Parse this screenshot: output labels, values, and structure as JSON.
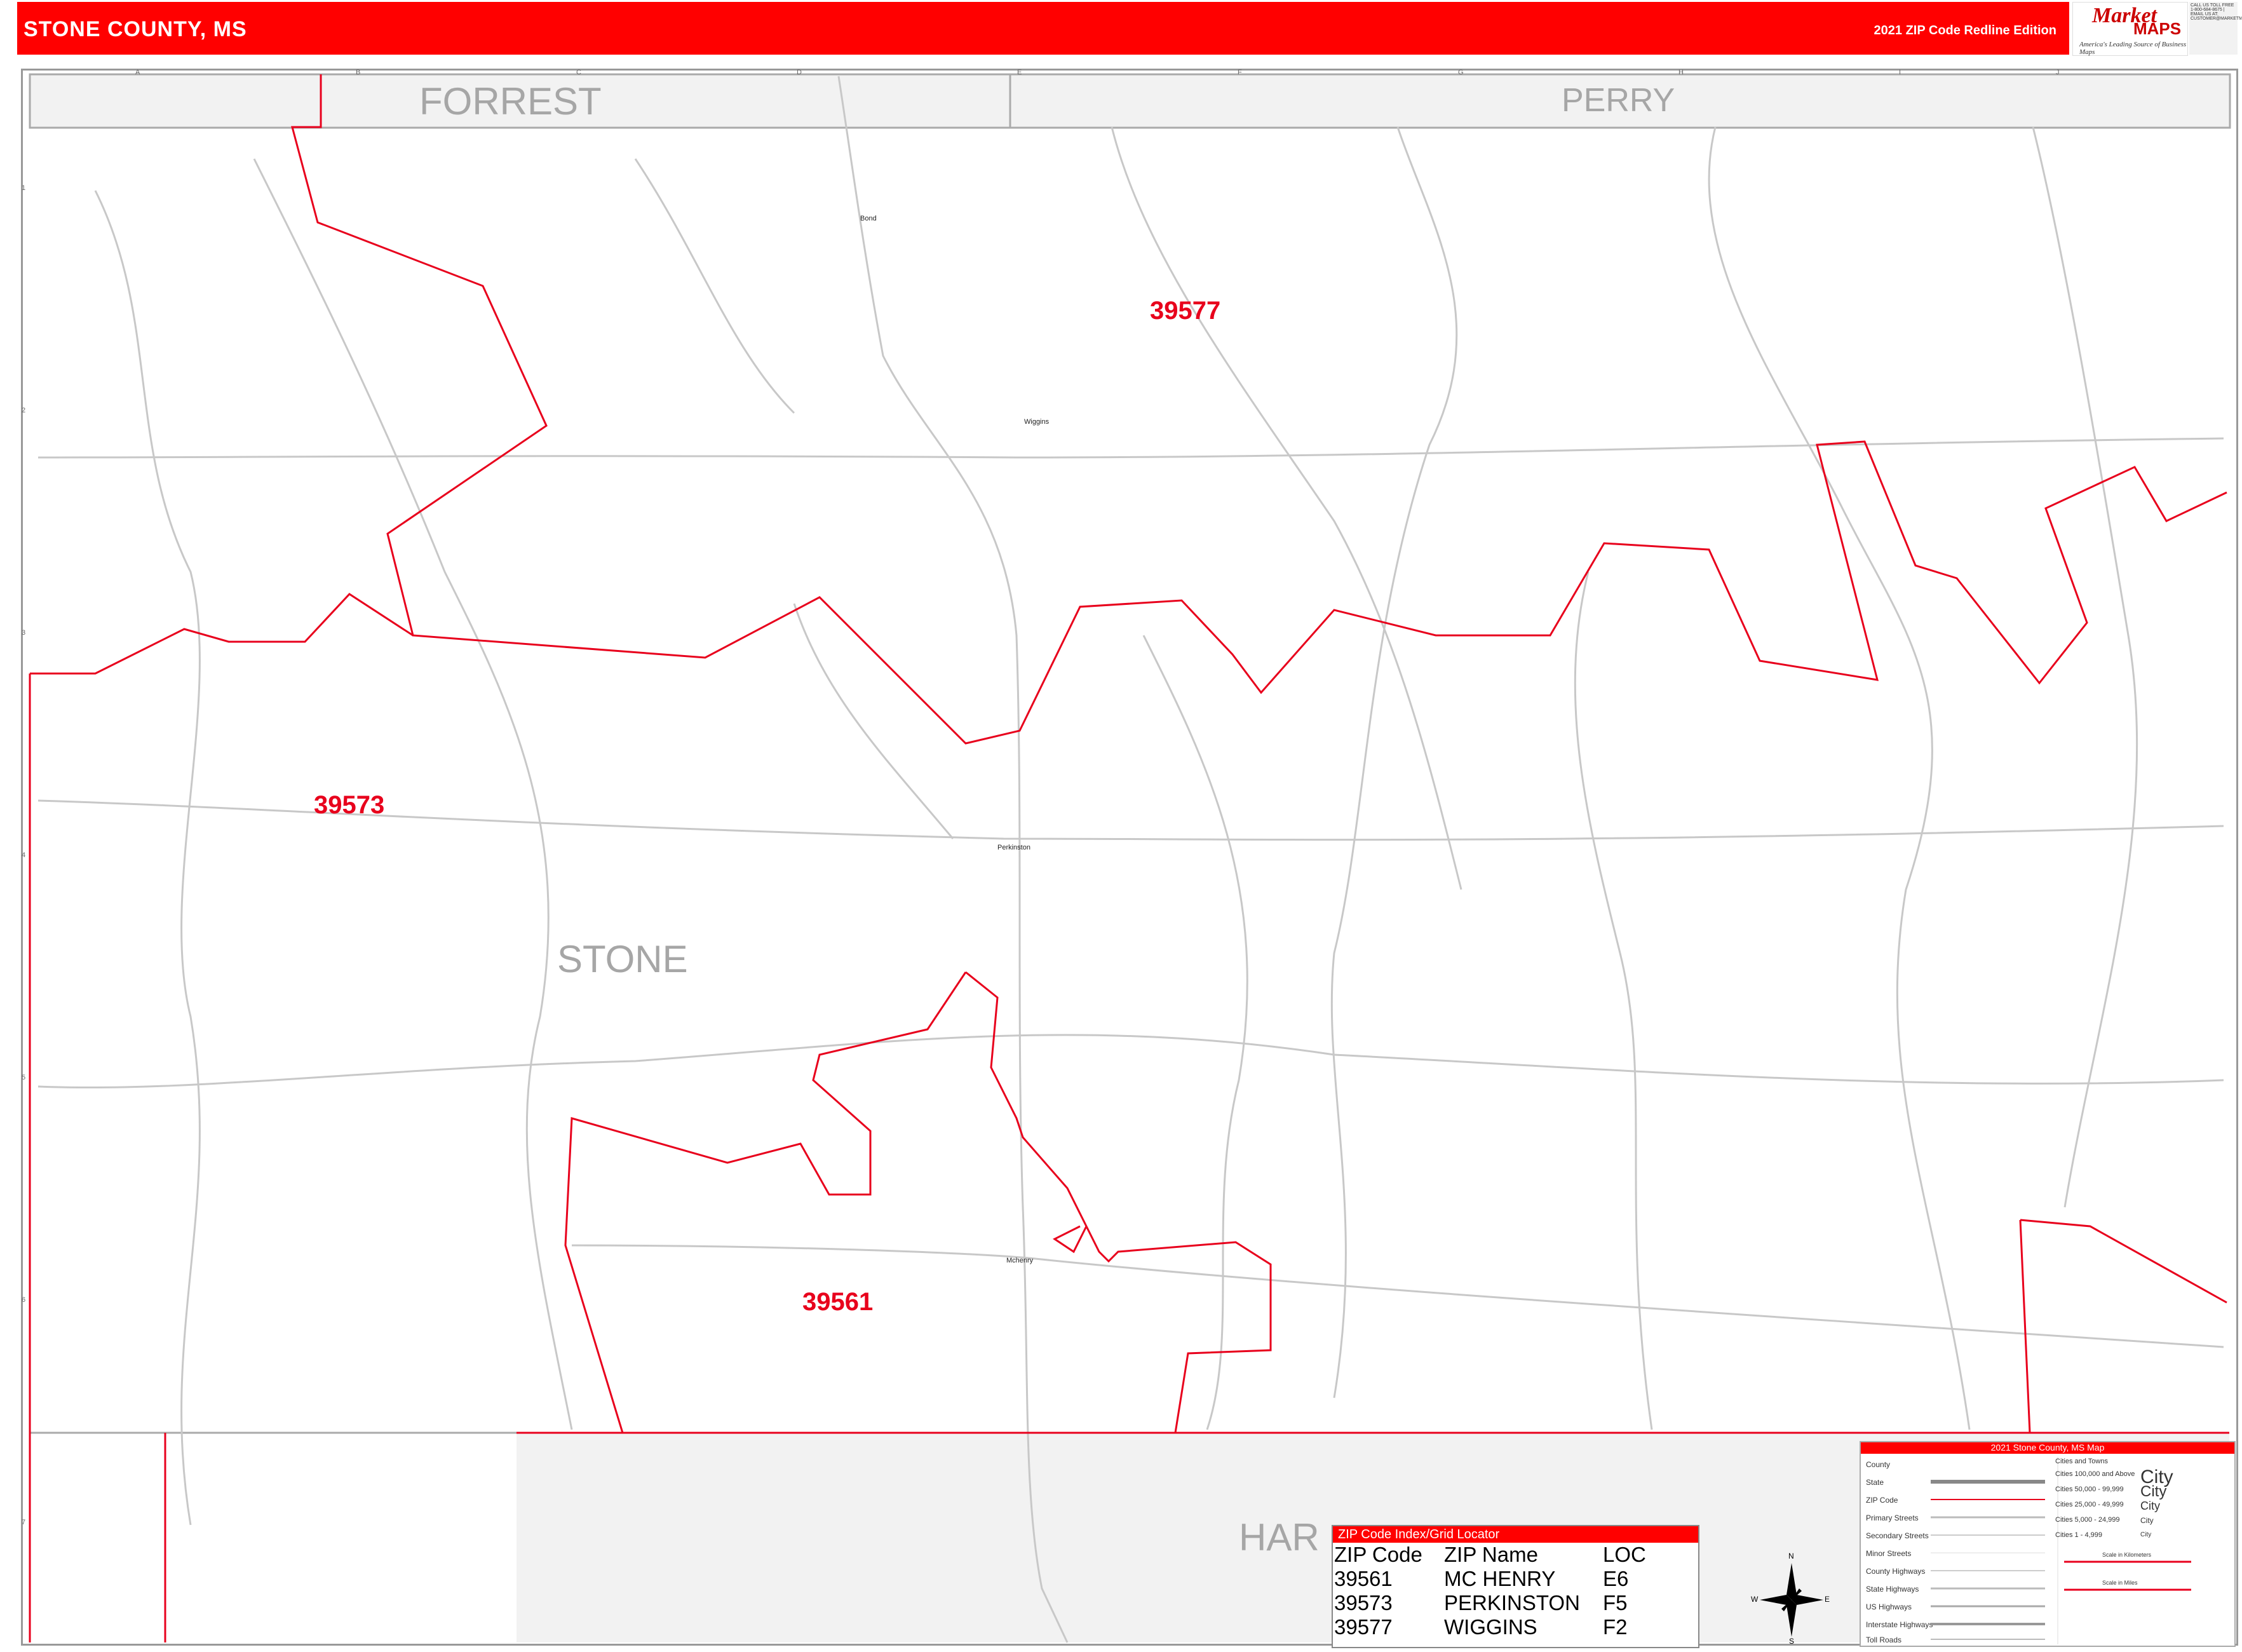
{
  "header": {
    "title": "STONE COUNTY, MS",
    "edition": "2021 ZIP Code Redline Edition",
    "brand": "Market MAPS",
    "brand_line1": "Market",
    "brand_line2": "MAPS",
    "brand_tagline": "America's Leading Source of Business Maps",
    "contact": "CALL US TOLL FREE 1-800-684-8675 | EMAIL US AT: CUSTOMER@MARKETMAPS.COM",
    "accent_color": "#ff0000"
  },
  "grid": {
    "columns": [
      "A",
      "B",
      "C",
      "D",
      "E",
      "F",
      "G",
      "H",
      "I",
      "J"
    ],
    "rows": [
      "1",
      "2",
      "3",
      "4",
      "5",
      "6",
      "7"
    ]
  },
  "counties": {
    "forrest": "FORREST",
    "perry": "PERRY",
    "stone": "STONE",
    "harrison": "HAR"
  },
  "zip_labels": [
    "39577",
    "39573",
    "39561"
  ],
  "towns": {
    "bond": "Bond",
    "wiggins": "Wiggins",
    "perkinston": "Perkinston",
    "mchenry": "Mchenry"
  },
  "zip_index": {
    "title": "ZIP Code Index/Grid Locator",
    "headers": [
      "ZIP Code",
      "ZIP Name",
      "LOC"
    ],
    "rows": [
      [
        "39561",
        "MC HENRY",
        "E6"
      ],
      [
        "39573",
        "PERKINSTON",
        "F5"
      ],
      [
        "39577",
        "WIGGINS",
        "F2"
      ]
    ]
  },
  "legend": {
    "title": "2021 Stone County, MS Map",
    "items": [
      "County",
      "State",
      "ZIP Code",
      "Primary Streets",
      "Secondary Streets",
      "Minor Streets",
      "County Highways",
      "State Highways",
      "US Highways",
      "Interstate Highways",
      "Toll Roads"
    ],
    "cities_title": "Cities and Towns",
    "cities": [
      "Cities 100,000 and Above",
      "Cities 50,000 - 99,999",
      "Cities 25,000 - 49,999",
      "Cities 5,000 - 24,999",
      "Cities 1 - 4,999"
    ],
    "city_word": "City",
    "scale_km": "Scale in Kilometers",
    "scale_mi": "Scale in Miles"
  },
  "compass": {
    "n": "N",
    "s": "S",
    "e": "E",
    "w": "W"
  },
  "colors": {
    "zip_boundary": "#e8001c",
    "road": "#c8c8c8",
    "county_label": "#a6a6a6",
    "neighbor_fill": "#f2f2f2"
  }
}
